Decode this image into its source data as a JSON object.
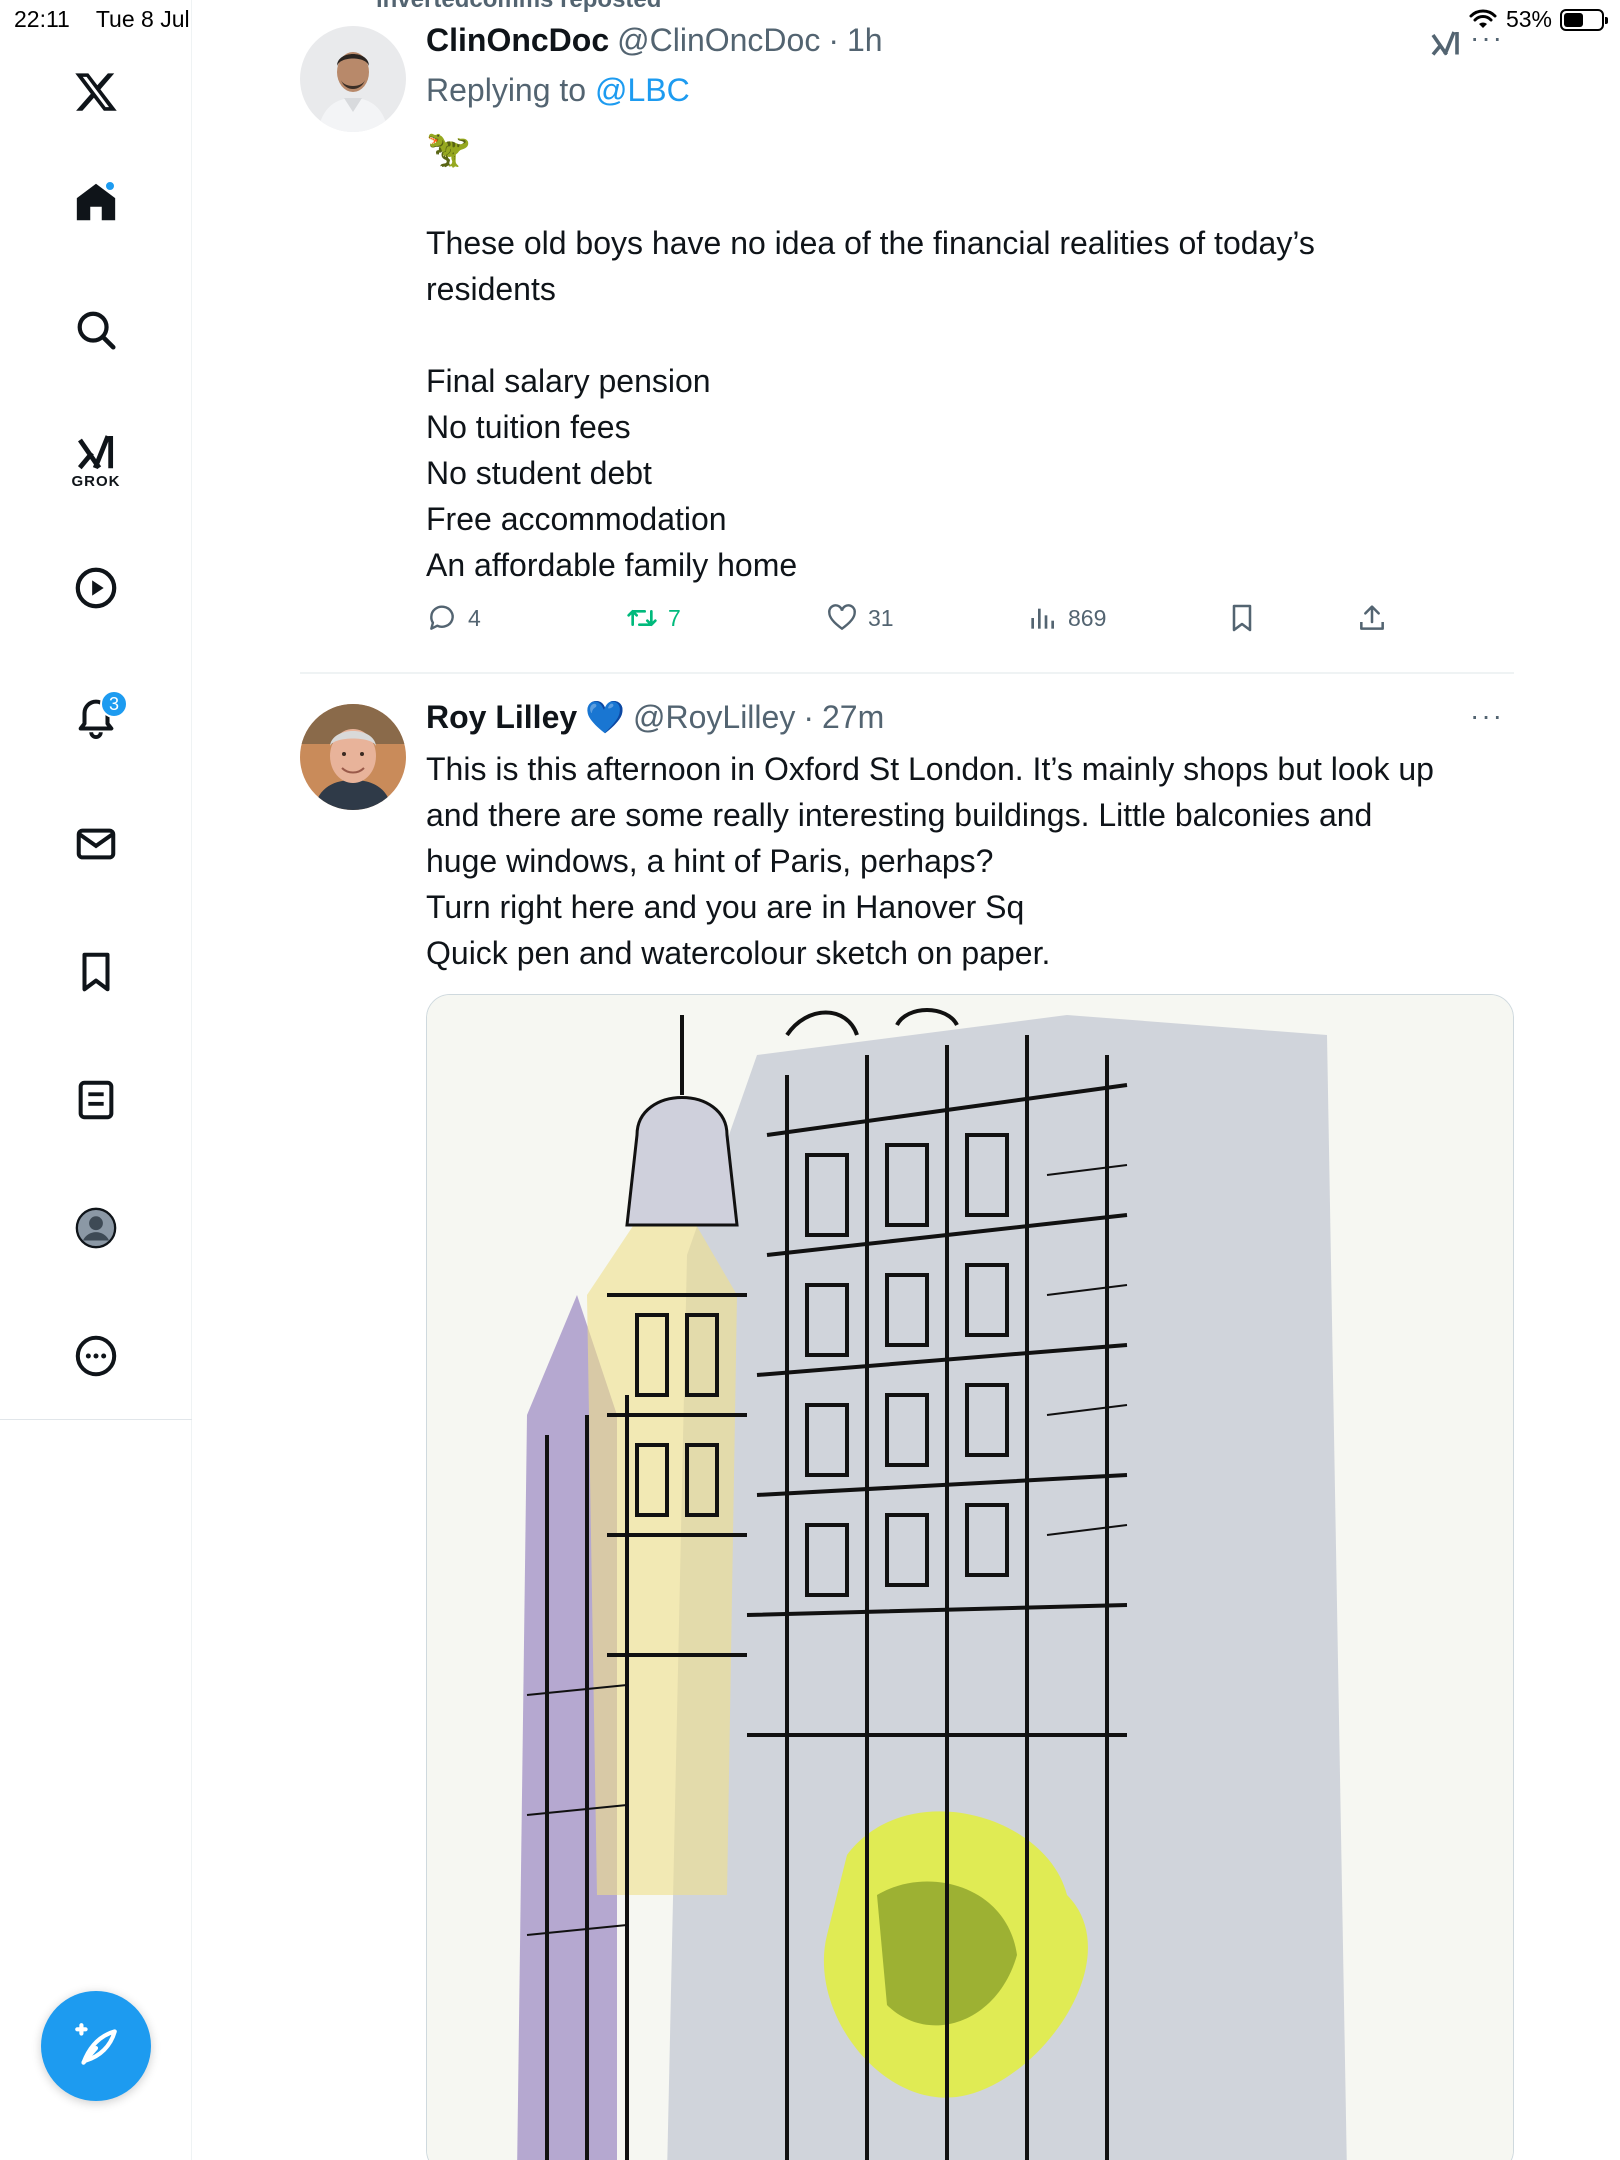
{
  "status_bar": {
    "time": "22:11",
    "date": "Tue 8 Jul",
    "battery": "53%"
  },
  "sidebar": {
    "items": [
      {
        "name": "home",
        "icon": "home-icon",
        "has_dot": true
      },
      {
        "name": "search",
        "icon": "search-icon"
      },
      {
        "name": "grok",
        "icon": "grok-icon",
        "label": "GROK"
      },
      {
        "name": "video",
        "icon": "play-icon"
      },
      {
        "name": "notifications",
        "icon": "bell-icon",
        "badge": "3"
      },
      {
        "name": "messages",
        "icon": "mail-icon"
      },
      {
        "name": "bookmarks",
        "icon": "bookmark-icon"
      },
      {
        "name": "lists",
        "icon": "list-icon"
      },
      {
        "name": "profile",
        "icon": "profile-icon"
      },
      {
        "name": "more",
        "icon": "more-icon"
      }
    ],
    "compose_icon": "compose-icon"
  },
  "feed": {
    "reposted_by": "invertedcomms reposted",
    "tweets": [
      {
        "display_name": "ClinOncDoc",
        "handle": "@ClinOncDoc",
        "separator": "·",
        "time": "1h",
        "replying_prefix": "Replying to",
        "replying_to": "@LBC",
        "emoji": "🦖",
        "lines": [
          "These old boys have no idea of the financial realities of today’s",
          "residents"
        ],
        "list_lines": [
          "Final salary pension",
          "No tuition fees",
          "No student debt",
          "Free accommodation",
          "An affordable family home"
        ],
        "stats": {
          "replies": "4",
          "reposts": "7",
          "likes": "31",
          "views": "869"
        },
        "colors": {
          "repost_active": "#00ba7c"
        }
      },
      {
        "display_name": "Roy Lilley",
        "verified_emoji": "💙",
        "handle": "@RoyLilley",
        "separator": "·",
        "time": "27m",
        "lines": [
          "This is this afternoon in Oxford St London. It’s mainly shops but look up",
          "and there are some really interesting buildings. Little balconies and",
          "huge windows, a hint of Paris, perhaps?",
          "Turn right here and you are in Hanover Sq",
          "Quick pen and watercolour sketch on paper."
        ],
        "media": "watercolour-sketch-image"
      }
    ]
  },
  "colors": {
    "accent": "#1d9bf0",
    "text": "#0f1419",
    "muted": "#536471"
  }
}
